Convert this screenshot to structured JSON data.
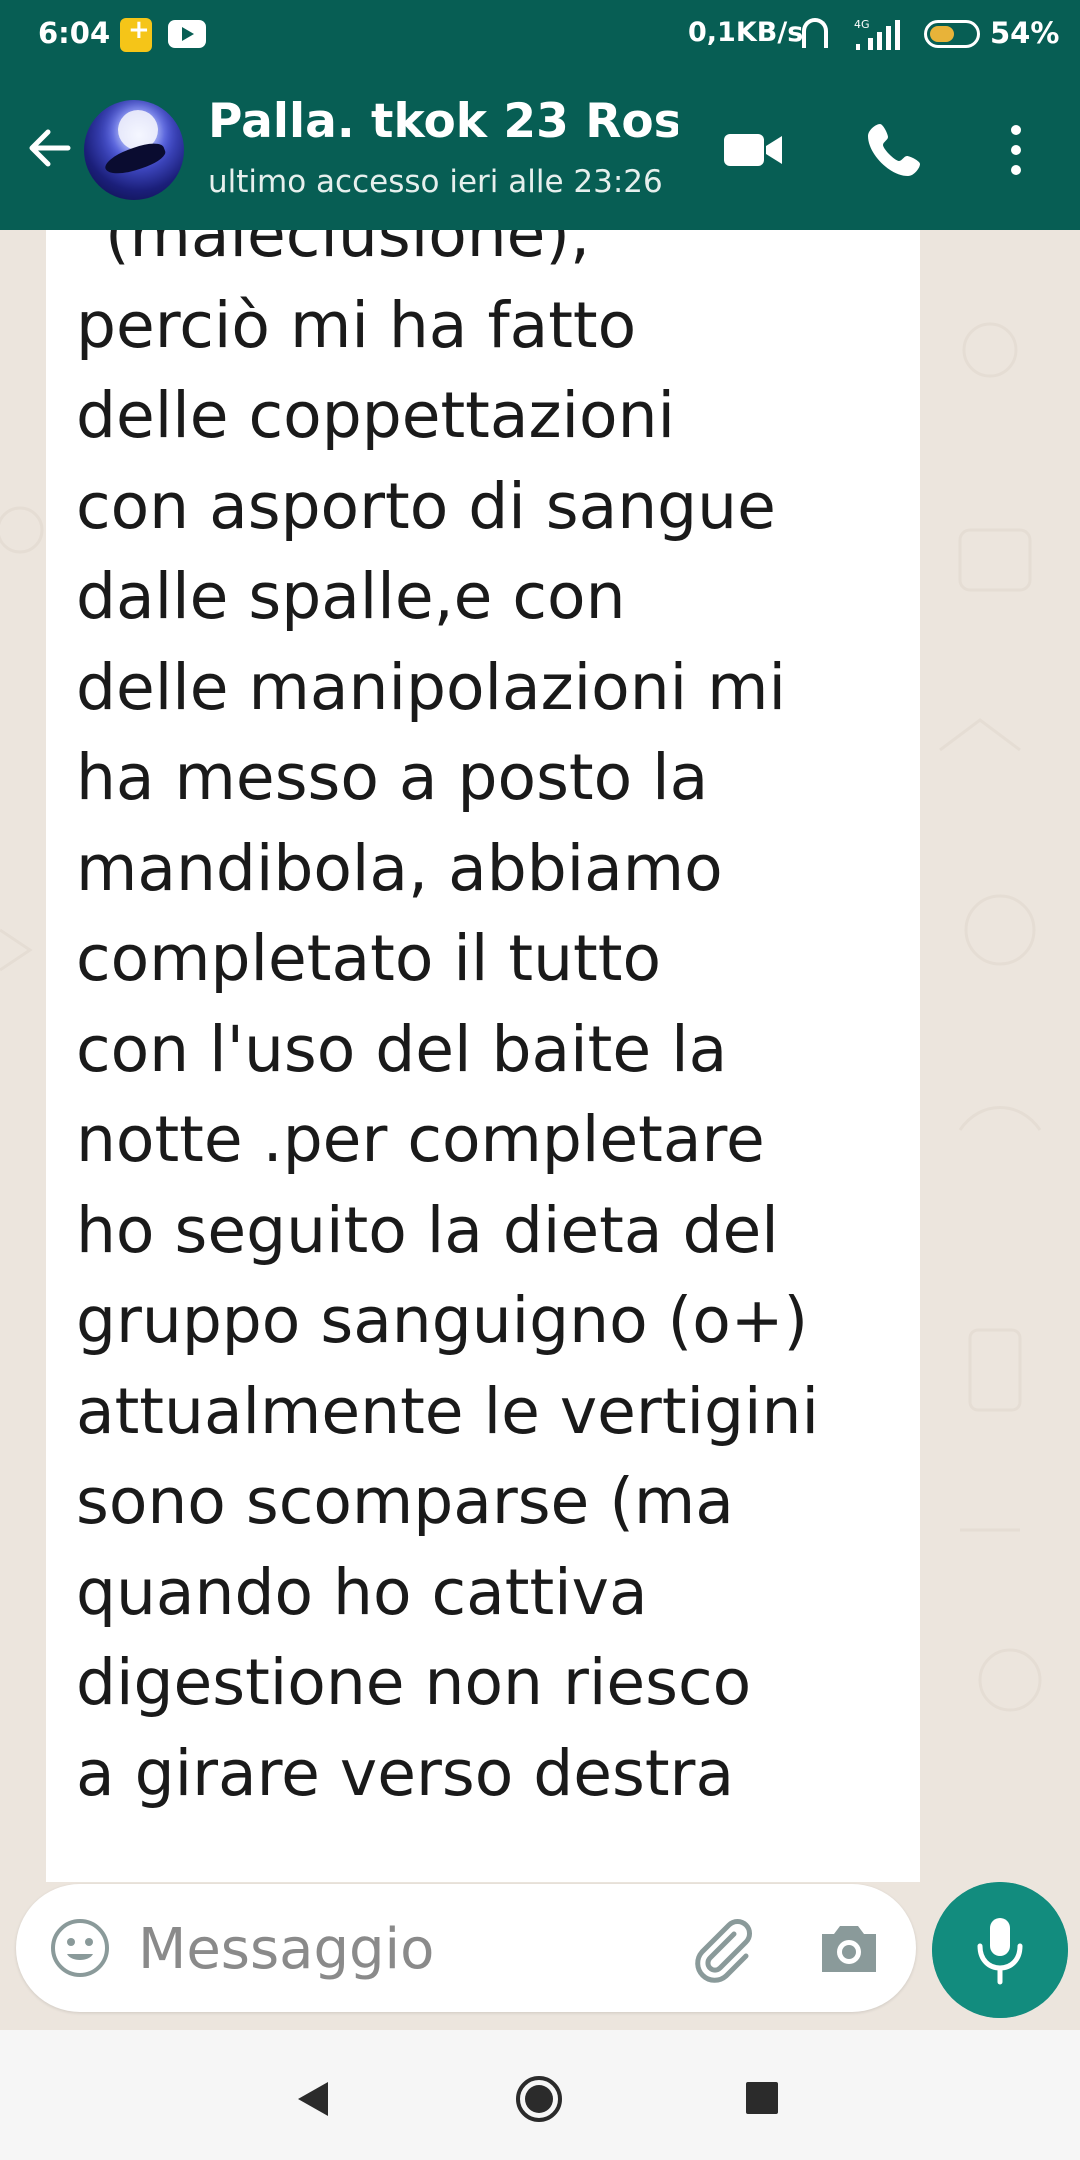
{
  "status_bar": {
    "time": "6:04",
    "speed": "0,1KB/s",
    "network": "4G",
    "battery_percent": 54,
    "battery_label": "54%"
  },
  "header": {
    "contact_name": "Palla. tkok 23 Ros...",
    "last_seen": "ultimo accesso ieri alle 23:26"
  },
  "message": {
    "text": "\"(maleclusione),\nperciò mi ha fatto\ndelle coppettazioni\ncon asporto di sangue\ndalle spalle,e con\ndelle manipolazioni mi\nha messo a posto la\nmandibola, abbiamo\ncompletato il tutto\ncon l'uso del baite la\nnotte .per completare\nho seguito la dieta del\ngruppo sanguigno (o+)\nattualmente le vertigini\nsono scomparse (ma\nquando ho cattiva\ndigestione non riesco\na girare verso destra"
  },
  "composer": {
    "placeholder": "Messaggio"
  },
  "colors": {
    "header": "#075e54",
    "accent": "#128c7e",
    "chat_background": "#ece5dd"
  },
  "icons": [
    "back-arrow-icon",
    "video-call-icon",
    "phone-icon",
    "more-options-icon",
    "emoji-icon",
    "attach-icon",
    "camera-icon",
    "mic-icon",
    "chevrons-down-icon"
  ]
}
